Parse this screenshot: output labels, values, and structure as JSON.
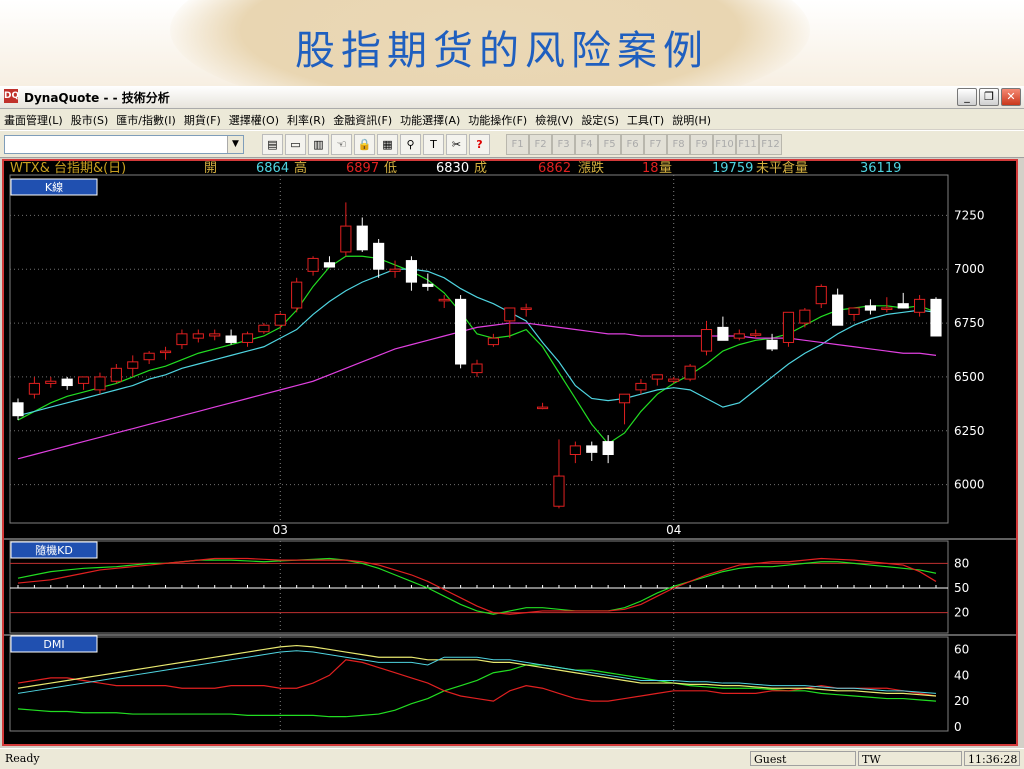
{
  "slide": {
    "title": "股指期货的风险案例"
  },
  "window": {
    "title": "DynaQuote - - 技術分析",
    "app_icon": "DQ"
  },
  "menu": [
    "畫面管理(L)",
    "股市(S)",
    "匯市/指數(I)",
    "期貨(F)",
    "選擇權(O)",
    "利率(R)",
    "金融資訊(F)",
    "功能選擇(A)",
    "功能操作(F)",
    "檢視(V)",
    "設定(S)",
    "工具(T)",
    "說明(H)"
  ],
  "toolbar": {
    "combo_value": "",
    "icons": [
      "new-chart-icon",
      "window-icon",
      "color-bars-icon",
      "hand-icon",
      "lock-icon",
      "report-icon",
      "search-icon",
      "text-tool-icon",
      "tools-icon",
      "help-icon"
    ],
    "fkeys": [
      "F1",
      "F2",
      "F3",
      "F4",
      "F5",
      "F6",
      "F7",
      "F8",
      "F9",
      "F10",
      "F11",
      "F12"
    ]
  },
  "quote": {
    "symbol": "WTX& 台指期&(日)",
    "open_label": "開",
    "open": "6864",
    "high_label": "高",
    "high": "6897",
    "low_label": "低",
    "low": "6830",
    "volume_label": "成",
    "close": "6862",
    "change_label": "漲跌",
    "change": "18",
    "qty_label": "量",
    "qty": "19759",
    "oi_label": "未平倉量",
    "oi": "36119"
  },
  "panels": {
    "k": "K線",
    "kd": "隨機KD",
    "dmi": "DMI"
  },
  "axes": {
    "price_ticks": [
      "7250",
      "7000",
      "6750",
      "6500",
      "6250",
      "6000"
    ],
    "kd_ticks": [
      "80",
      "50",
      "20"
    ],
    "dmi_ticks": [
      "60",
      "40",
      "20",
      "0"
    ],
    "x_ticks": [
      "03",
      "04"
    ]
  },
  "colors": {
    "up": "#e02020",
    "down": "#ffffff",
    "ma_short": "#22dd22",
    "ma_mid": "#4fd4e0",
    "ma_long": "#e040e0",
    "k": "#22dd22",
    "d": "#e02020"
  },
  "chart_data": [
    {
      "type": "candlestick",
      "title": "K線",
      "ylim": [
        5850,
        7400
      ],
      "x_labels": {
        "03": 16,
        "04": 40
      },
      "candles": [
        [
          6380,
          6400,
          6300,
          6320
        ],
        [
          6420,
          6500,
          6400,
          6470
        ],
        [
          6470,
          6500,
          6450,
          6480
        ],
        [
          6490,
          6500,
          6440,
          6460
        ],
        [
          6470,
          6500,
          6440,
          6500
        ],
        [
          6440,
          6520,
          6420,
          6500
        ],
        [
          6480,
          6560,
          6470,
          6540
        ],
        [
          6540,
          6600,
          6500,
          6570
        ],
        [
          6580,
          6620,
          6560,
          6610
        ],
        [
          6620,
          6640,
          6580,
          6620
        ],
        [
          6650,
          6720,
          6630,
          6700
        ],
        [
          6680,
          6720,
          6660,
          6700
        ],
        [
          6690,
          6720,
          6670,
          6700
        ],
        [
          6690,
          6720,
          6650,
          6660
        ],
        [
          6660,
          6710,
          6640,
          6700
        ],
        [
          6710,
          6750,
          6700,
          6740
        ],
        [
          6740,
          6800,
          6720,
          6790
        ],
        [
          6820,
          6960,
          6800,
          6940
        ],
        [
          6990,
          7060,
          6970,
          7050
        ],
        [
          7030,
          7060,
          7010,
          7010
        ],
        [
          7080,
          7310,
          7060,
          7200
        ],
        [
          7200,
          7240,
          7080,
          7090
        ],
        [
          7120,
          7140,
          6960,
          7000
        ],
        [
          6990,
          7040,
          6960,
          7000
        ],
        [
          7040,
          7060,
          6900,
          6940
        ],
        [
          6930,
          6980,
          6900,
          6920
        ],
        [
          6860,
          6880,
          6820,
          6860
        ],
        [
          6860,
          6880,
          6540,
          6560
        ],
        [
          6520,
          6580,
          6500,
          6560
        ],
        [
          6650,
          6700,
          6640,
          6680
        ],
        [
          6760,
          6820,
          6680,
          6820
        ],
        [
          6820,
          6840,
          6780,
          6820
        ],
        [
          6360,
          6380,
          6350,
          6360
        ],
        [
          5900,
          6210,
          5890,
          6040
        ],
        [
          6140,
          6200,
          6100,
          6180
        ],
        [
          6180,
          6200,
          6110,
          6150
        ],
        [
          6200,
          6230,
          6100,
          6140
        ],
        [
          6380,
          6420,
          6280,
          6420
        ],
        [
          6440,
          6490,
          6420,
          6470
        ],
        [
          6490,
          6500,
          6460,
          6510
        ],
        [
          6480,
          6500,
          6470,
          6490
        ],
        [
          6490,
          6560,
          6480,
          6550
        ],
        [
          6620,
          6760,
          6600,
          6720
        ],
        [
          6730,
          6780,
          6720,
          6670
        ],
        [
          6680,
          6720,
          6670,
          6700
        ],
        [
          6700,
          6720,
          6680,
          6700
        ],
        [
          6670,
          6700,
          6620,
          6630
        ],
        [
          6660,
          6720,
          6640,
          6800
        ],
        [
          6750,
          6820,
          6730,
          6810
        ],
        [
          6840,
          6930,
          6820,
          6920
        ],
        [
          6880,
          6910,
          6820,
          6740
        ],
        [
          6790,
          6820,
          6760,
          6820
        ],
        [
          6830,
          6860,
          6790,
          6810
        ],
        [
          6820,
          6870,
          6800,
          6820
        ],
        [
          6840,
          6890,
          6820,
          6820
        ],
        [
          6800,
          6880,
          6780,
          6860
        ],
        [
          6860,
          6870,
          6720,
          6690
        ]
      ],
      "series": [
        {
          "name": "MA-short",
          "values": [
            6300,
            6340,
            6380,
            6410,
            6430,
            6450,
            6470,
            6500,
            6530,
            6550,
            6580,
            6610,
            6630,
            6650,
            6670,
            6690,
            6730,
            6810,
            6920,
            7010,
            7060,
            7060,
            7050,
            7020,
            6990,
            6950,
            6890,
            6800,
            6700,
            6680,
            6690,
            6720,
            6640,
            6520,
            6400,
            6280,
            6190,
            6240,
            6340,
            6420,
            6470,
            6510,
            6560,
            6620,
            6650,
            6670,
            6680,
            6700,
            6740,
            6780,
            6810,
            6820,
            6830,
            6830,
            6820,
            6830,
            6800
          ]
        },
        {
          "name": "MA-mid",
          "values": [
            6320,
            6340,
            6360,
            6380,
            6400,
            6420,
            6440,
            6460,
            6490,
            6510,
            6540,
            6560,
            6580,
            6600,
            6620,
            6640,
            6680,
            6720,
            6790,
            6850,
            6900,
            6940,
            6970,
            7000,
            7000,
            6990,
            6960,
            6910,
            6870,
            6840,
            6800,
            6760,
            6660,
            6570,
            6460,
            6400,
            6390,
            6400,
            6420,
            6440,
            6450,
            6440,
            6400,
            6360,
            6380,
            6440,
            6500,
            6560,
            6610,
            6650,
            6700,
            6740,
            6770,
            6790,
            6800,
            6810,
            6800
          ]
        },
        {
          "name": "MA-long",
          "values": [
            6120,
            6140,
            6160,
            6180,
            6200,
            6220,
            6240,
            6260,
            6280,
            6300,
            6320,
            6340,
            6360,
            6380,
            6400,
            6420,
            6440,
            6460,
            6480,
            6510,
            6540,
            6570,
            6600,
            6630,
            6650,
            6670,
            6690,
            6710,
            6730,
            6740,
            6750,
            6750,
            6740,
            6730,
            6720,
            6710,
            6700,
            6700,
            6690,
            6690,
            6690,
            6690,
            6690,
            6690,
            6690,
            6680,
            6680,
            6680,
            6670,
            6660,
            6650,
            6640,
            6630,
            6620,
            6610,
            6610,
            6600
          ]
        }
      ]
    },
    {
      "type": "line",
      "title": "隨機KD",
      "ylim": [
        0,
        100
      ],
      "series": [
        {
          "name": "K",
          "values": [
            62,
            66,
            70,
            72,
            74,
            75,
            76,
            78,
            80,
            80,
            82,
            84,
            84,
            84,
            83,
            82,
            83,
            84,
            85,
            86,
            84,
            80,
            74,
            66,
            58,
            50,
            40,
            30,
            22,
            18,
            22,
            26,
            26,
            24,
            22,
            22,
            22,
            26,
            34,
            44,
            52,
            58,
            64,
            70,
            74,
            76,
            76,
            78,
            80,
            82,
            82,
            80,
            78,
            76,
            74,
            72,
            68
          ]
        },
        {
          "name": "D",
          "values": [
            56,
            58,
            60,
            64,
            68,
            72,
            74,
            76,
            78,
            80,
            82,
            84,
            86,
            86,
            86,
            85,
            84,
            84,
            84,
            84,
            84,
            82,
            78,
            72,
            66,
            58,
            48,
            38,
            28,
            20,
            18,
            20,
            22,
            22,
            22,
            22,
            22,
            24,
            30,
            40,
            50,
            58,
            66,
            72,
            78,
            80,
            82,
            82,
            84,
            86,
            85,
            84,
            82,
            80,
            78,
            70,
            58
          ]
        }
      ]
    },
    {
      "type": "line",
      "title": "DMI",
      "ylim": [
        0,
        65
      ],
      "series": [
        {
          "name": "+DI",
          "values": [
            14,
            13,
            12,
            12,
            11,
            11,
            11,
            10,
            10,
            10,
            10,
            10,
            10,
            10,
            9,
            9,
            9,
            9,
            9,
            8,
            8,
            9,
            10,
            13,
            18,
            22,
            28,
            32,
            36,
            42,
            44,
            48,
            48,
            46,
            44,
            44,
            42,
            40,
            38,
            36,
            34,
            32,
            31,
            30,
            30,
            30,
            29,
            28,
            28,
            26,
            25,
            24,
            23,
            22,
            22,
            21,
            20
          ]
        },
        {
          "name": "-DI",
          "values": [
            34,
            36,
            38,
            38,
            36,
            34,
            32,
            32,
            32,
            32,
            30,
            30,
            30,
            32,
            32,
            32,
            30,
            30,
            34,
            40,
            52,
            50,
            46,
            42,
            38,
            34,
            28,
            24,
            22,
            20,
            28,
            32,
            30,
            26,
            22,
            20,
            20,
            22,
            24,
            26,
            28,
            28,
            28,
            26,
            26,
            26,
            28,
            28,
            30,
            32,
            30,
            30,
            30,
            30,
            28,
            26,
            24
          ]
        },
        {
          "name": "ADX",
          "values": [
            30,
            32,
            34,
            36,
            38,
            40,
            42,
            44,
            46,
            48,
            50,
            52,
            54,
            56,
            58,
            60,
            62,
            63,
            62,
            60,
            58,
            56,
            54,
            54,
            54,
            52,
            52,
            52,
            52,
            50,
            50,
            48,
            46,
            44,
            42,
            40,
            38,
            36,
            34,
            34,
            34,
            33,
            33,
            32,
            32,
            31,
            30,
            30,
            30,
            29,
            28,
            28,
            27,
            26,
            26,
            25,
            24
          ]
        }
      ]
    }
  ],
  "statusbar": {
    "ready": "Ready",
    "user": "Guest",
    "market": "TW",
    "time": "11:36:28"
  }
}
